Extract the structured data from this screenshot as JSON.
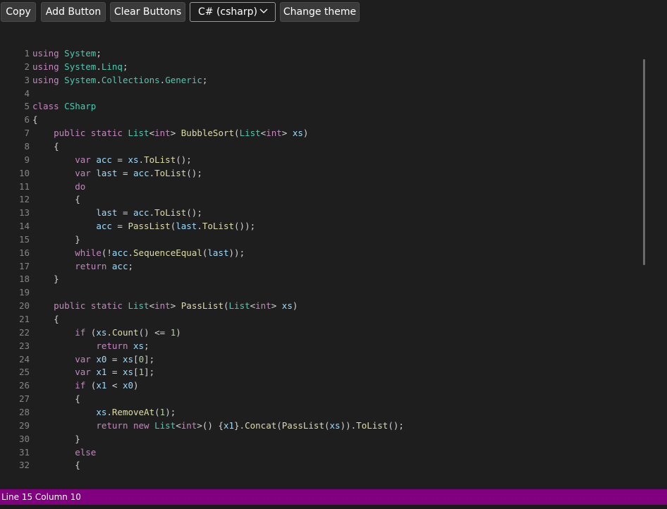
{
  "toolbar": {
    "copy_label": "Copy",
    "add_label": "Add Button",
    "clear_label": "Clear Buttons",
    "language_selected": "C# (csharp)",
    "theme_label": "Change theme"
  },
  "status": {
    "text": "Line 15 Column 10"
  },
  "colors": {
    "status_bar": "#800080",
    "keyword": "#c586c0",
    "type": "#4ec9b0",
    "method": "#dcdcaa",
    "variable": "#9cdcfe",
    "number": "#b5cea8",
    "text": "#d4d4d4"
  },
  "code": {
    "lines": [
      [
        [
          "k",
          "using"
        ],
        [
          "p",
          " "
        ],
        [
          "t",
          "System"
        ],
        [
          "p",
          ";"
        ]
      ],
      [
        [
          "k",
          "using"
        ],
        [
          "p",
          " "
        ],
        [
          "t",
          "System"
        ],
        [
          "p",
          "."
        ],
        [
          "t",
          "Linq"
        ],
        [
          "p",
          ";"
        ]
      ],
      [
        [
          "k",
          "using"
        ],
        [
          "p",
          " "
        ],
        [
          "t",
          "System"
        ],
        [
          "p",
          "."
        ],
        [
          "t",
          "Collections"
        ],
        [
          "p",
          "."
        ],
        [
          "t",
          "Generic"
        ],
        [
          "p",
          ";"
        ]
      ],
      [],
      [
        [
          "k",
          "class"
        ],
        [
          "p",
          " "
        ],
        [
          "t",
          "CSharp"
        ]
      ],
      [
        [
          "p",
          "{"
        ]
      ],
      [
        [
          "p",
          "    "
        ],
        [
          "k",
          "public"
        ],
        [
          "p",
          " "
        ],
        [
          "k",
          "static"
        ],
        [
          "p",
          " "
        ],
        [
          "t",
          "List"
        ],
        [
          "p",
          "<"
        ],
        [
          "k",
          "int"
        ],
        [
          "p",
          "> "
        ],
        [
          "m",
          "BubbleSort"
        ],
        [
          "p",
          "("
        ],
        [
          "t",
          "List"
        ],
        [
          "p",
          "<"
        ],
        [
          "k",
          "int"
        ],
        [
          "p",
          "> "
        ],
        [
          "v",
          "xs"
        ],
        [
          "p",
          ")"
        ]
      ],
      [
        [
          "p",
          "    {"
        ]
      ],
      [
        [
          "p",
          "        "
        ],
        [
          "k",
          "var"
        ],
        [
          "p",
          " "
        ],
        [
          "v",
          "acc"
        ],
        [
          "p",
          " = "
        ],
        [
          "v",
          "xs"
        ],
        [
          "p",
          "."
        ],
        [
          "m",
          "ToList"
        ],
        [
          "p",
          "();"
        ]
      ],
      [
        [
          "p",
          "        "
        ],
        [
          "k",
          "var"
        ],
        [
          "p",
          " "
        ],
        [
          "v",
          "last"
        ],
        [
          "p",
          " = "
        ],
        [
          "v",
          "acc"
        ],
        [
          "p",
          "."
        ],
        [
          "m",
          "ToList"
        ],
        [
          "p",
          "();"
        ]
      ],
      [
        [
          "p",
          "        "
        ],
        [
          "k",
          "do"
        ]
      ],
      [
        [
          "p",
          "        {"
        ]
      ],
      [
        [
          "p",
          "            "
        ],
        [
          "v",
          "last"
        ],
        [
          "p",
          " = "
        ],
        [
          "v",
          "acc"
        ],
        [
          "p",
          "."
        ],
        [
          "m",
          "ToList"
        ],
        [
          "p",
          "();"
        ]
      ],
      [
        [
          "p",
          "            "
        ],
        [
          "v",
          "acc"
        ],
        [
          "p",
          " = "
        ],
        [
          "m",
          "PassList"
        ],
        [
          "p",
          "("
        ],
        [
          "v",
          "last"
        ],
        [
          "p",
          "."
        ],
        [
          "m",
          "ToList"
        ],
        [
          "p",
          "());"
        ]
      ],
      [
        [
          "p",
          "        }"
        ]
      ],
      [
        [
          "p",
          "        "
        ],
        [
          "k",
          "while"
        ],
        [
          "p",
          "(!"
        ],
        [
          "v",
          "acc"
        ],
        [
          "p",
          "."
        ],
        [
          "m",
          "SequenceEqual"
        ],
        [
          "p",
          "("
        ],
        [
          "v",
          "last"
        ],
        [
          "p",
          "));"
        ]
      ],
      [
        [
          "p",
          "        "
        ],
        [
          "k",
          "return"
        ],
        [
          "p",
          " "
        ],
        [
          "v",
          "acc"
        ],
        [
          "p",
          ";"
        ]
      ],
      [
        [
          "p",
          "    }"
        ]
      ],
      [],
      [
        [
          "p",
          "    "
        ],
        [
          "k",
          "public"
        ],
        [
          "p",
          " "
        ],
        [
          "k",
          "static"
        ],
        [
          "p",
          " "
        ],
        [
          "t",
          "List"
        ],
        [
          "p",
          "<"
        ],
        [
          "k",
          "int"
        ],
        [
          "p",
          "> "
        ],
        [
          "m",
          "PassList"
        ],
        [
          "p",
          "("
        ],
        [
          "t",
          "List"
        ],
        [
          "p",
          "<"
        ],
        [
          "k",
          "int"
        ],
        [
          "p",
          "> "
        ],
        [
          "v",
          "xs"
        ],
        [
          "p",
          ")"
        ]
      ],
      [
        [
          "p",
          "    {"
        ]
      ],
      [
        [
          "p",
          "        "
        ],
        [
          "k",
          "if"
        ],
        [
          "p",
          " ("
        ],
        [
          "v",
          "xs"
        ],
        [
          "p",
          "."
        ],
        [
          "m",
          "Count"
        ],
        [
          "p",
          "() <= "
        ],
        [
          "n",
          "1"
        ],
        [
          "p",
          ")"
        ]
      ],
      [
        [
          "p",
          "            "
        ],
        [
          "k",
          "return"
        ],
        [
          "p",
          " "
        ],
        [
          "v",
          "xs"
        ],
        [
          "p",
          ";"
        ]
      ],
      [
        [
          "p",
          "        "
        ],
        [
          "k",
          "var"
        ],
        [
          "p",
          " "
        ],
        [
          "v",
          "x0"
        ],
        [
          "p",
          " = "
        ],
        [
          "v",
          "xs"
        ],
        [
          "p",
          "["
        ],
        [
          "n",
          "0"
        ],
        [
          "p",
          "];"
        ]
      ],
      [
        [
          "p",
          "        "
        ],
        [
          "k",
          "var"
        ],
        [
          "p",
          " "
        ],
        [
          "v",
          "x1"
        ],
        [
          "p",
          " = "
        ],
        [
          "v",
          "xs"
        ],
        [
          "p",
          "["
        ],
        [
          "n",
          "1"
        ],
        [
          "p",
          "];"
        ]
      ],
      [
        [
          "p",
          "        "
        ],
        [
          "k",
          "if"
        ],
        [
          "p",
          " ("
        ],
        [
          "v",
          "x1"
        ],
        [
          "p",
          " < "
        ],
        [
          "v",
          "x0"
        ],
        [
          "p",
          ")"
        ]
      ],
      [
        [
          "p",
          "        {"
        ]
      ],
      [
        [
          "p",
          "            "
        ],
        [
          "v",
          "xs"
        ],
        [
          "p",
          "."
        ],
        [
          "m",
          "RemoveAt"
        ],
        [
          "p",
          "("
        ],
        [
          "n",
          "1"
        ],
        [
          "p",
          ");"
        ]
      ],
      [
        [
          "p",
          "            "
        ],
        [
          "k",
          "return"
        ],
        [
          "p",
          " "
        ],
        [
          "k",
          "new"
        ],
        [
          "p",
          " "
        ],
        [
          "t",
          "List"
        ],
        [
          "p",
          "<"
        ],
        [
          "k",
          "int"
        ],
        [
          "p",
          ">() {"
        ],
        [
          "v",
          "x1"
        ],
        [
          "p",
          "}."
        ],
        [
          "m",
          "Concat"
        ],
        [
          "p",
          "("
        ],
        [
          "m",
          "PassList"
        ],
        [
          "p",
          "("
        ],
        [
          "v",
          "xs"
        ],
        [
          "p",
          "))."
        ],
        [
          "m",
          "ToList"
        ],
        [
          "p",
          "();"
        ]
      ],
      [
        [
          "p",
          "        }"
        ]
      ],
      [
        [
          "p",
          "        "
        ],
        [
          "k",
          "else"
        ]
      ],
      [
        [
          "p",
          "        {"
        ]
      ]
    ]
  }
}
